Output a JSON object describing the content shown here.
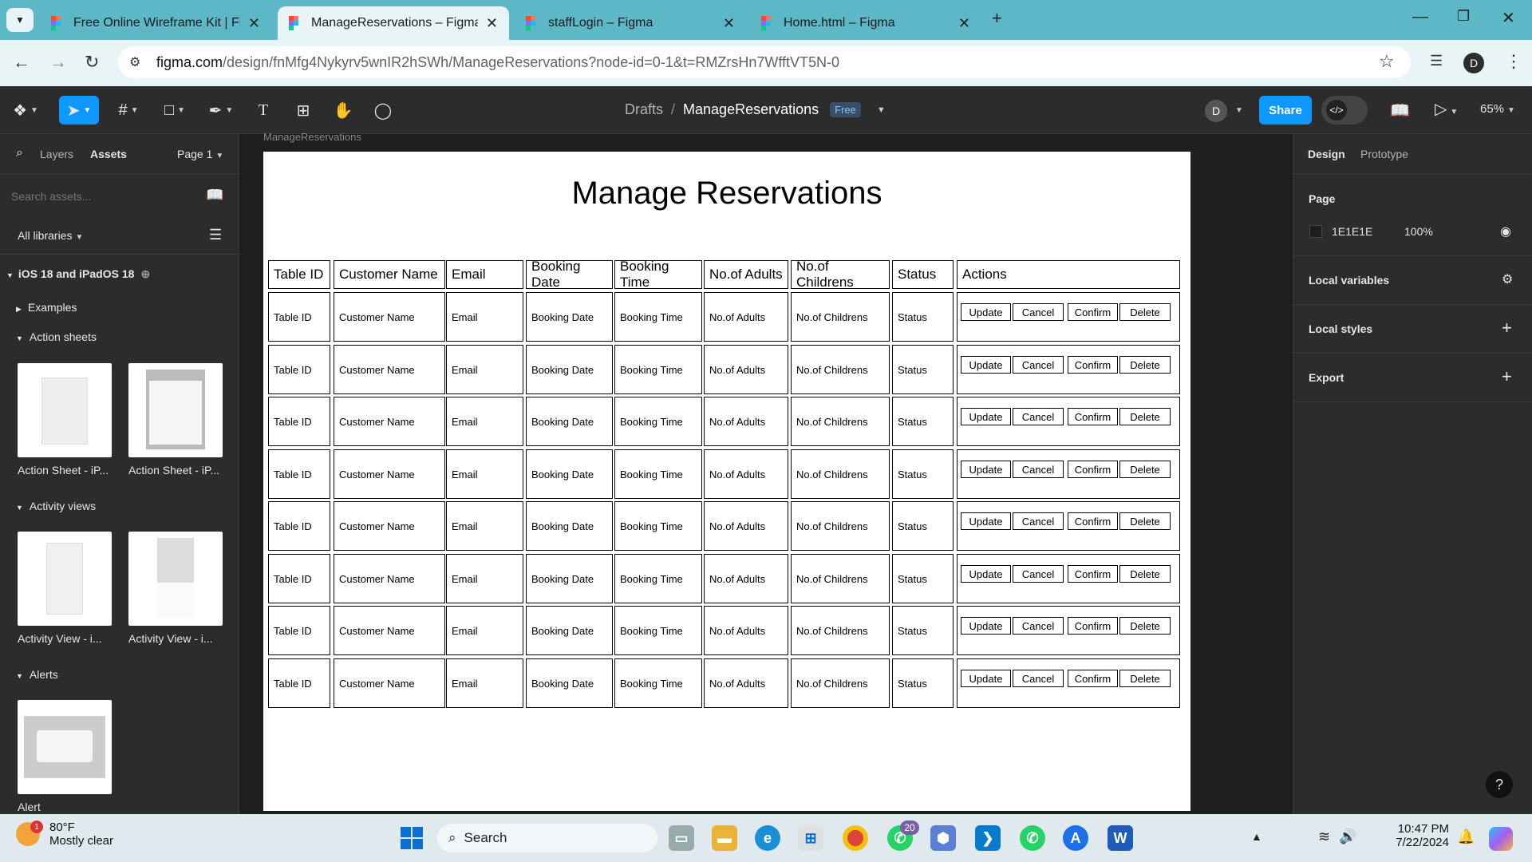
{
  "browser": {
    "tabs": [
      {
        "title": "Free Online Wireframe Kit | Figma"
      },
      {
        "title": "ManageReservations – Figma"
      },
      {
        "title": "staffLogin – Figma"
      },
      {
        "title": "Home.html – Figma"
      }
    ],
    "url_domain": "figma.com",
    "url_path": "/design/fnMfg4Nykyrv5wnIR2hSWh/ManageReservations?node-id=0-1&t=RMZrsHn7WfftVT5N-0",
    "profile_initial": "D"
  },
  "figma": {
    "breadcrumb_drafts": "Drafts",
    "breadcrumb_sep": "/",
    "file_name": "ManageReservations",
    "plan_badge": "Free",
    "user_initial": "D",
    "share_label": "Share",
    "zoom": "65%",
    "frame_label": "ManageReservations"
  },
  "left_panel": {
    "tab_layers": "Layers",
    "tab_assets": "Assets",
    "page": "Page 1",
    "search_placeholder": "Search assets...",
    "libraries": "All libraries",
    "library_name": "iOS 18 and iPadOS 18",
    "sections": [
      {
        "label": "Examples"
      },
      {
        "label": "Action sheets"
      },
      {
        "label": "Activity views"
      },
      {
        "label": "Alerts"
      }
    ],
    "thumbs": [
      {
        "caption": "Action Sheet - iP..."
      },
      {
        "caption": "Action Sheet - iP..."
      },
      {
        "caption": "Activity View - i..."
      },
      {
        "caption": "Activity View - i..."
      },
      {
        "caption": "Alert"
      }
    ]
  },
  "right_panel": {
    "tab_design": "Design",
    "tab_prototype": "Prototype",
    "page_heading": "Page",
    "page_color": "1E1E1E",
    "page_opacity": "100%",
    "local_variables": "Local variables",
    "local_styles": "Local styles",
    "export": "Export"
  },
  "design": {
    "title": "Manage Reservations",
    "headers": [
      "Table ID",
      "Customer Name",
      "Email",
      "Booking Date",
      "Booking Time",
      "No.of Adults",
      "No.of Childrens",
      "Status",
      "Actions"
    ],
    "row": [
      "Table ID",
      "Customer Name",
      "Email",
      "Booking Date",
      "Booking Time",
      "No.of Adults",
      "No.of Childrens",
      "Status"
    ],
    "actions": [
      "Update",
      "Cancel",
      "Confirm",
      "Delete"
    ],
    "row_count": 8
  },
  "taskbar": {
    "weather_temp": "80°F",
    "weather_desc": "Mostly clear",
    "weather_badge": "1",
    "search_label": "Search",
    "whatsapp_badge": "20",
    "time": "10:47 PM",
    "date": "7/22/2024"
  },
  "colors": {
    "accent": "#0d99ff",
    "tabbar": "#5cb8c6",
    "panel": "#2c2c2c",
    "canvas": "#1e1e1e"
  }
}
